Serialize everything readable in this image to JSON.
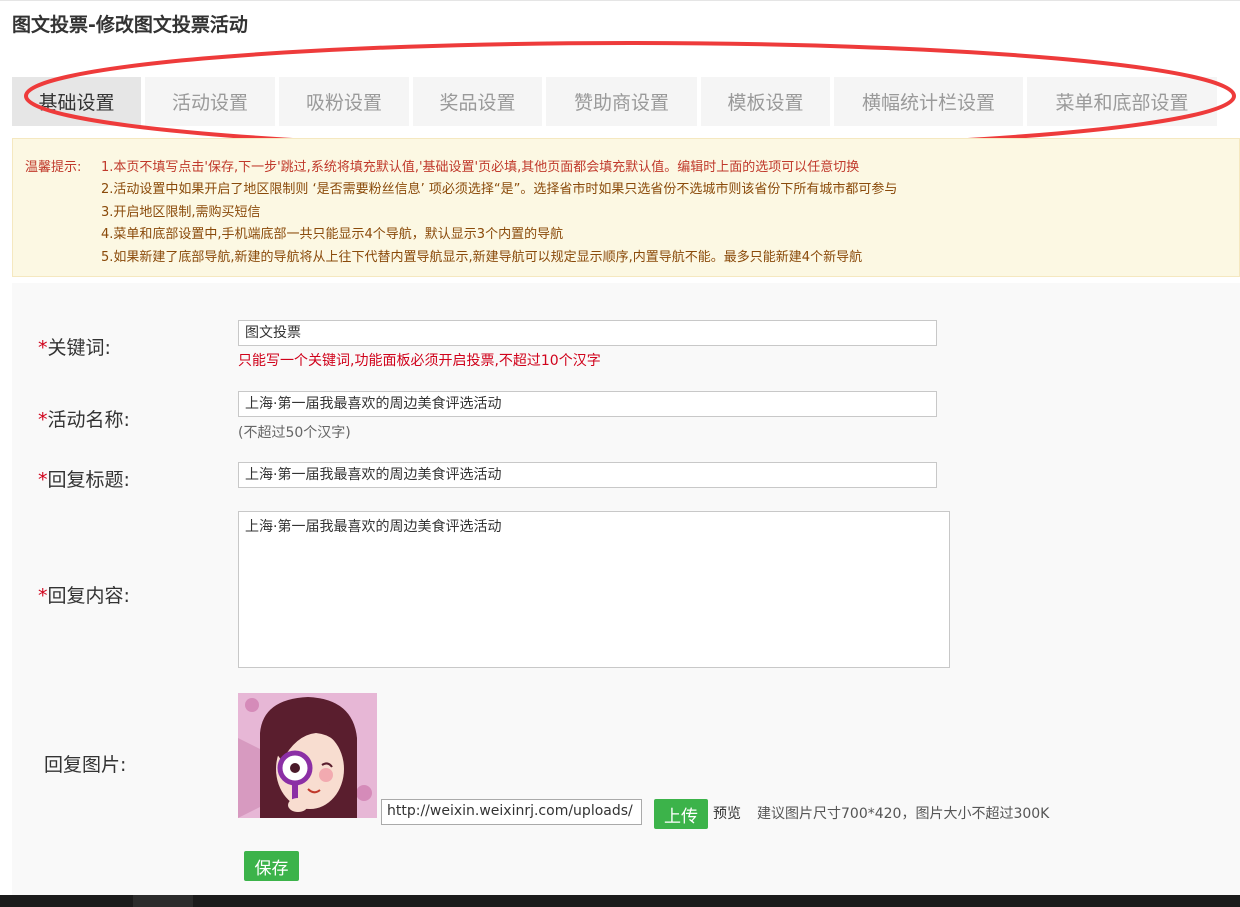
{
  "page": {
    "title": "图文投票-修改图文投票活动"
  },
  "tabs": [
    {
      "label": "基础设置",
      "active": true
    },
    {
      "label": "活动设置"
    },
    {
      "label": "吸粉设置"
    },
    {
      "label": "奖品设置"
    },
    {
      "label": "赞助商设置"
    },
    {
      "label": "模板设置"
    },
    {
      "label": "横幅统计栏设置"
    },
    {
      "label": "菜单和底部设置"
    }
  ],
  "tips": {
    "label": "温馨提示:",
    "lines": [
      "1.本页不填写点击'保存,下一步'跳过,系统将填充默认值,'基础设置'页必填,其他页面都会填充默认值。编辑时上面的选项可以任意切换",
      "2.活动设置中如果开启了地区限制则 ‘是否需要粉丝信息’ 项必须选择“是”。选择省市时如果只选省份不选城市则该省份下所有城市都可参与",
      "3.开启地区限制,需购买短信",
      "4.菜单和底部设置中,手机端底部一共只能显示4个导航，默认显示3个内置的导航",
      "5.如果新建了底部导航,新建的导航将从上往下代替内置导航显示,新建导航可以规定显示顺序,内置导航不能。最多只能新建4个新导航"
    ]
  },
  "form": {
    "required_mark": "*",
    "keyword": {
      "label": "关键词:",
      "value": "图文投票",
      "hint": "只能写一个关键词,功能面板必须开启投票,不超过10个汉字"
    },
    "activity_name": {
      "label": "活动名称:",
      "value": "上海·第一届我最喜欢的周边美食评选活动",
      "hint": "(不超过50个汉字)"
    },
    "reply_title": {
      "label": "回复标题:",
      "value": "上海·第一届我最喜欢的周边美食评选活动"
    },
    "reply_content": {
      "label": "回复内容:",
      "value": "上海·第一届我最喜欢的周边美食评选活动"
    },
    "reply_image": {
      "label": "回复图片:",
      "url": "http://weixin.weixinrj.com/uploads/",
      "upload_label": "上传",
      "preview_label": "预览",
      "size_hint": "建议图片尺寸700*420，图片大小不超过300K"
    },
    "save_label": "保存"
  },
  "colors": {
    "required": "#d0021b",
    "tip_red": "#c0392b",
    "button_green": "#3cb34a",
    "annotation_ring": "#ee3b3b"
  }
}
